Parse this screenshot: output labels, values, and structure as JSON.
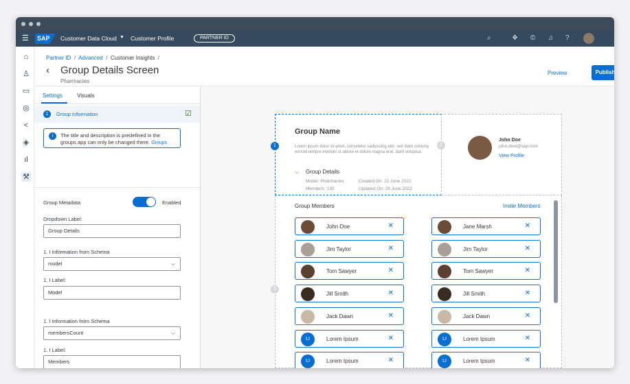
{
  "shell": {
    "product": "Customer Data Cloud",
    "app": "Customer Profile",
    "partner": "PARTNER ID"
  },
  "header": {
    "breadcrumb": [
      "Partner ID",
      "Advanced",
      "Customer Insights"
    ],
    "title": "Group Details Screen",
    "subtitle": "Pharmacies",
    "preview": "Preview",
    "publish": "Publish"
  },
  "tabs": [
    "Settings",
    "Visuals"
  ],
  "group_info": {
    "num": "1",
    "label": "Group Information",
    "info": "The title and description is predefined in the groups app can only be changed there.",
    "link": "Groups"
  },
  "meta": {
    "label": "Group Metadata",
    "toggle": "Enabled",
    "dropdown_label": "Dropdown Label:",
    "dropdown_value": "Group Details",
    "f1_schema": "1.  I  Information from Schema",
    "f1_value": "model",
    "f1_label": "1.  I  Label:",
    "f1_label_value": "Model",
    "f2_schema": "1.  I  Information from Schema",
    "f2_value": "membersCount",
    "f2_label": "1.  I  Label:",
    "f2_label_value": "Members"
  },
  "preview": {
    "group_name": "Group Name",
    "lorem": "Lorem ipsum dolor sit amet, consetetur sadipscing elitr, sed diam nonumy eirmod tempor invidunt ut labore et dolore magna erat, diam voluptua.",
    "details": "Group Details",
    "model": "Model:  Pharmacies",
    "members": "Members:  130",
    "created": "Created On:  22 June 2022",
    "updated": "Updated On: 29 June 2022",
    "user_name": "John Doe",
    "user_email": "john.dow@sap.com",
    "view_profile": "View Profile",
    "members_title": "Group Members",
    "invite": "Invite Members",
    "b1": "1",
    "b2": "2",
    "b3": "3"
  },
  "members_left": [
    "John Doe",
    "Jim Taylor",
    "Tom Sawyer",
    "Jill Smith",
    "Jack Dawn",
    "Lorem Ipsum",
    "Lorem Ipsum"
  ],
  "members_right": [
    "Jane Marsh",
    "Jim Taylor",
    "Tom Sawyer",
    "Jill Smith",
    "Jack Dawn",
    "Lorem Ipsum",
    "Lorem Ipsum"
  ],
  "initials": "LI"
}
